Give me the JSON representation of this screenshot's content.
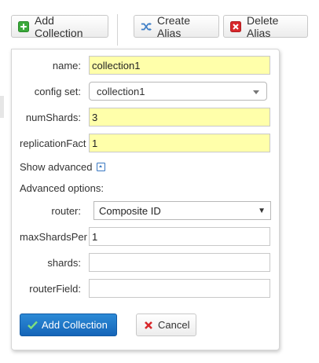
{
  "toolbar": {
    "add_collection": "Add Collection",
    "create_alias": "Create Alias",
    "delete_alias": "Delete Alias"
  },
  "form": {
    "name_label": "name:",
    "name_value": "collection1",
    "configset_label": "config set:",
    "configset_value": "collection1",
    "numshards_label": "numShards:",
    "numshards_value": "3",
    "replication_label": "replicationFact",
    "replication_value": "1",
    "show_advanced": "Show advanced",
    "advanced_options": "Advanced options:",
    "router_label": "router:",
    "router_value": "Composite ID",
    "maxshards_label": "maxShardsPer",
    "maxshards_value": "1",
    "shards_label": "shards:",
    "shards_value": "",
    "routerfield_label": "routerField:",
    "routerfield_value": "",
    "submit_label": "Add Collection",
    "cancel_label": "Cancel"
  },
  "colors": {
    "required_field_bg": "#ffffaa",
    "primary_button": "#1e74c6",
    "add_icon_green": "#3aa93a",
    "delete_icon_red": "#d8272b"
  },
  "icons": {
    "add": "plus-square-icon",
    "alias": "shuffle-arrows-icon",
    "delete": "x-square-icon",
    "advanced_toggle": "chevron-up-square-icon",
    "submit": "checkmark-icon",
    "cancel": "x-icon"
  }
}
